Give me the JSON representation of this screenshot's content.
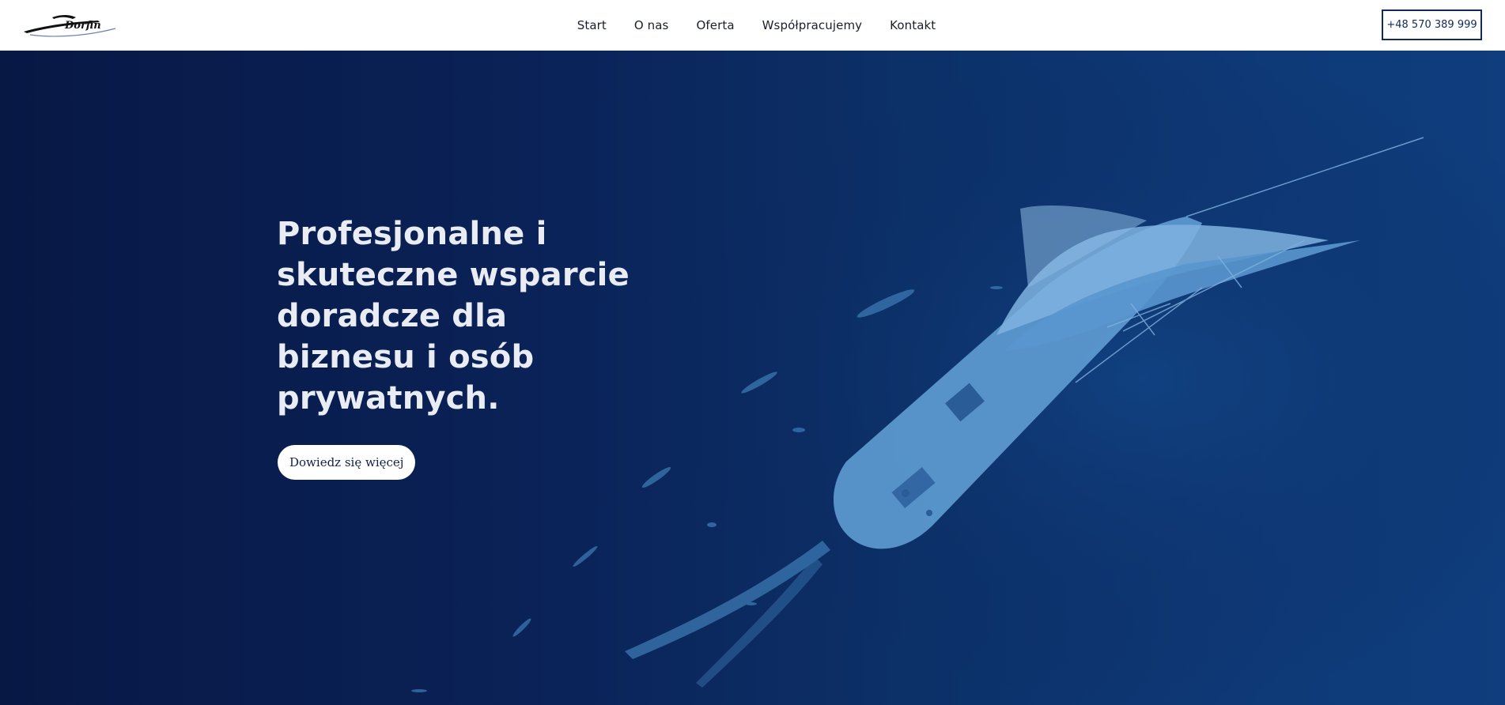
{
  "header": {
    "logo_text": "Dorfin",
    "nav": [
      {
        "label": "Start"
      },
      {
        "label": "O nas"
      },
      {
        "label": "Oferta"
      },
      {
        "label": "Współpracujemy"
      },
      {
        "label": "Kontakt"
      }
    ],
    "phone_label": "+48 570 389 999"
  },
  "hero": {
    "title": "Profesjonalne i skuteczne wsparcie doradcze dla biznesu i osób prywatnych.",
    "cta_label": "Dowiedz się więcej"
  },
  "colors": {
    "header_bg": "#ffffff",
    "hero_bg": "#0a2257",
    "accent": "#102a5c",
    "boat": "#4a8dc6"
  }
}
